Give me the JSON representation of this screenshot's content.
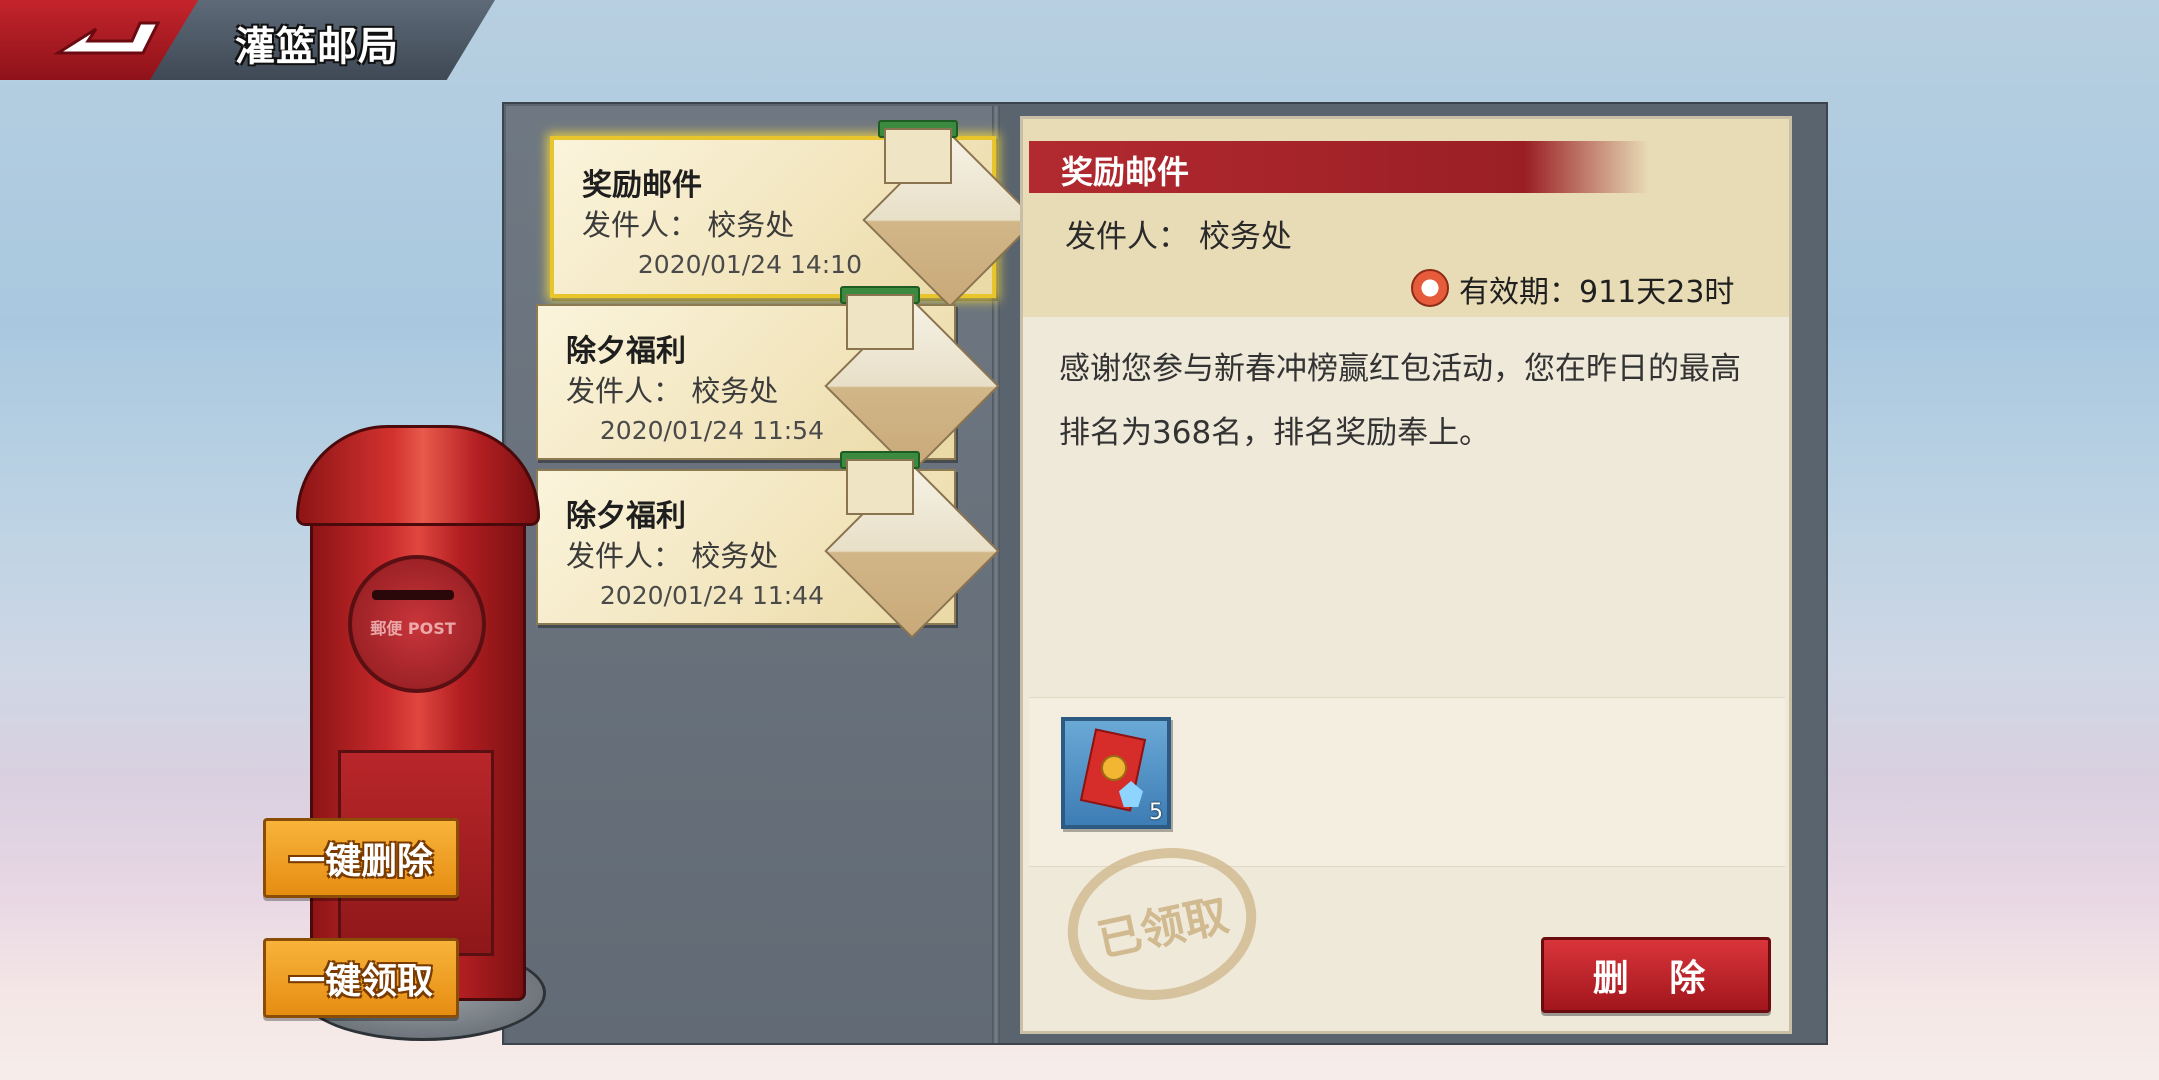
{
  "header": {
    "title": "灌篮邮局",
    "back_icon": "back-arrow-icon"
  },
  "mail_list": [
    {
      "title": "奖励邮件",
      "sender": "发件人： 校务处",
      "date": "2020/01/24 14:10",
      "selected": true
    },
    {
      "title": "除夕福利",
      "sender": "发件人： 校务处",
      "date": "2020/01/24 11:54",
      "selected": false
    },
    {
      "title": "除夕福利",
      "sender": "发件人： 校务处",
      "date": "2020/01/24 11:44",
      "selected": false
    }
  ],
  "detail": {
    "title": "奖励邮件",
    "sender": "发件人： 校务处",
    "expiry": "有效期：911天23时",
    "body": "感谢您参与新春冲榜赢红包活动，您在昨日的最高排名为368名，排名奖励奉上。",
    "attachment": {
      "icon": "red-envelope-icon",
      "count": "5"
    },
    "stamp": "已领取",
    "delete_label": "删 除"
  },
  "postbox": {
    "emblem_text": "郵便 POST"
  },
  "buttons": {
    "delete_all": "一键删除",
    "claim_all": "一键领取"
  }
}
